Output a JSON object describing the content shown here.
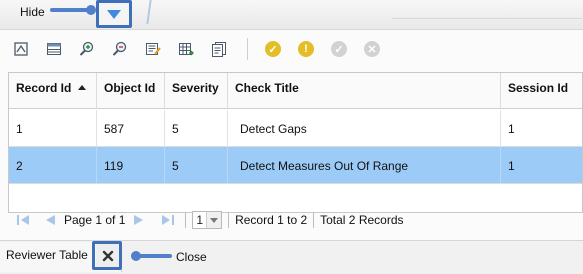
{
  "header": {
    "hide_label": "Hide"
  },
  "toolbar": {
    "tools": [
      "zoom-to-feature-icon",
      "attribute-table-icon",
      "zoom-in-icon",
      "zoom-out-icon",
      "edit-records-icon",
      "table-export-icon",
      "report-icon"
    ],
    "status_tools": [
      {
        "name": "acceptable-icon",
        "color": "#e3be26"
      },
      {
        "name": "warning-icon",
        "color": "#e3be26"
      },
      {
        "name": "verified-icon",
        "color": "#cfcfcf"
      },
      {
        "name": "exception-icon",
        "color": "#cfcfcf"
      }
    ]
  },
  "grid": {
    "columns": [
      "Record Id",
      "Object Id",
      "Severity",
      "Check Title",
      "Session Id"
    ],
    "sorted_column": "Record Id",
    "sort_direction": "ascending",
    "rows": [
      [
        "1",
        "587",
        "5",
        "Detect Gaps",
        "1"
      ],
      [
        "2",
        "119",
        "5",
        "Detect Measures Out Of Range",
        "1"
      ]
    ],
    "selected_row": 2,
    "selection_color": "#9ccbf7"
  },
  "pager": {
    "page_label": "Page 1 of 1",
    "page_value": "1",
    "records_label": "Record 1 to 2",
    "total_label": "Total 2 Records"
  },
  "footer": {
    "tab_label": "Reviewer Table",
    "close_label": "Close"
  },
  "colors": {
    "callout": "#4f80c9",
    "highlight_border": "#3f6fb8"
  }
}
